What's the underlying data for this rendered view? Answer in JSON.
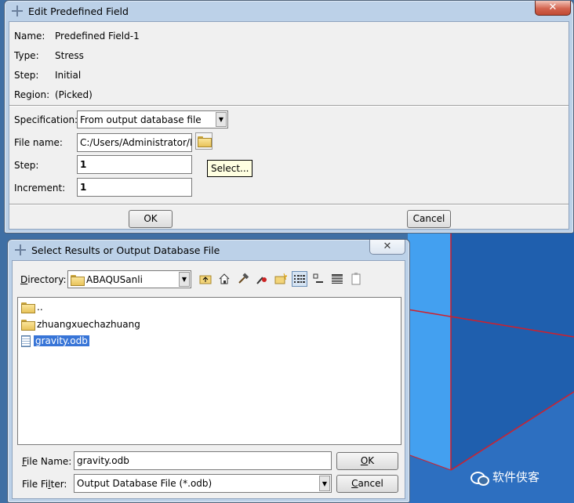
{
  "colors": {
    "viewport_blue": "#3f6fa4",
    "edge_red": "#d21f2a",
    "selection_blue": "#3875d7",
    "tooltip_yellow": "#ffffe1"
  },
  "edit_dialog": {
    "title": "Edit Predefined Field",
    "close_icon": "close-icon",
    "info": [
      {
        "label": "Name:",
        "value": "Predefined Field-1"
      },
      {
        "label": "Type:",
        "value": "Stress"
      },
      {
        "label": "Step:",
        "value": "Initial"
      },
      {
        "label": "Region:",
        "value": "(Picked)"
      }
    ],
    "specification": {
      "label": "Specification:",
      "value": "From output database file"
    },
    "file_name": {
      "label": "File name:",
      "value": "C:/Users/Administrator/D",
      "browse_icon": "open-folder-icon"
    },
    "step": {
      "label": "Step:",
      "value": "1",
      "select_label": "Select..."
    },
    "increment": {
      "label": "Increment:",
      "value": "1"
    },
    "ok_label": "OK",
    "cancel_label": "Cancel"
  },
  "select_dialog": {
    "title": "Select Results or Output Database File",
    "directory": {
      "label": "Directory:",
      "value": "ABAQUSanli"
    },
    "toolbar_icons": [
      "up-folder-icon",
      "home-icon",
      "hammer-icon",
      "bookmark-icon",
      "new-folder-icon",
      "list-view-icon",
      "icon-view-icon",
      "details-view-icon",
      "clipboard-icon"
    ],
    "files": [
      {
        "name": "..",
        "kind": "folder"
      },
      {
        "name": "zhuangxuechazhuang",
        "kind": "folder"
      },
      {
        "name": "gravity.odb",
        "kind": "file",
        "selected": true
      }
    ],
    "file_name": {
      "label": "File Name:",
      "value": "gravity.odb"
    },
    "file_filter": {
      "label": "File Filter:",
      "value": "Output Database File (*.odb)"
    },
    "ok_label": "OK",
    "cancel_label": "Cancel"
  },
  "watermark": {
    "text": "软件侠客",
    "icon": "wechat-icon"
  }
}
